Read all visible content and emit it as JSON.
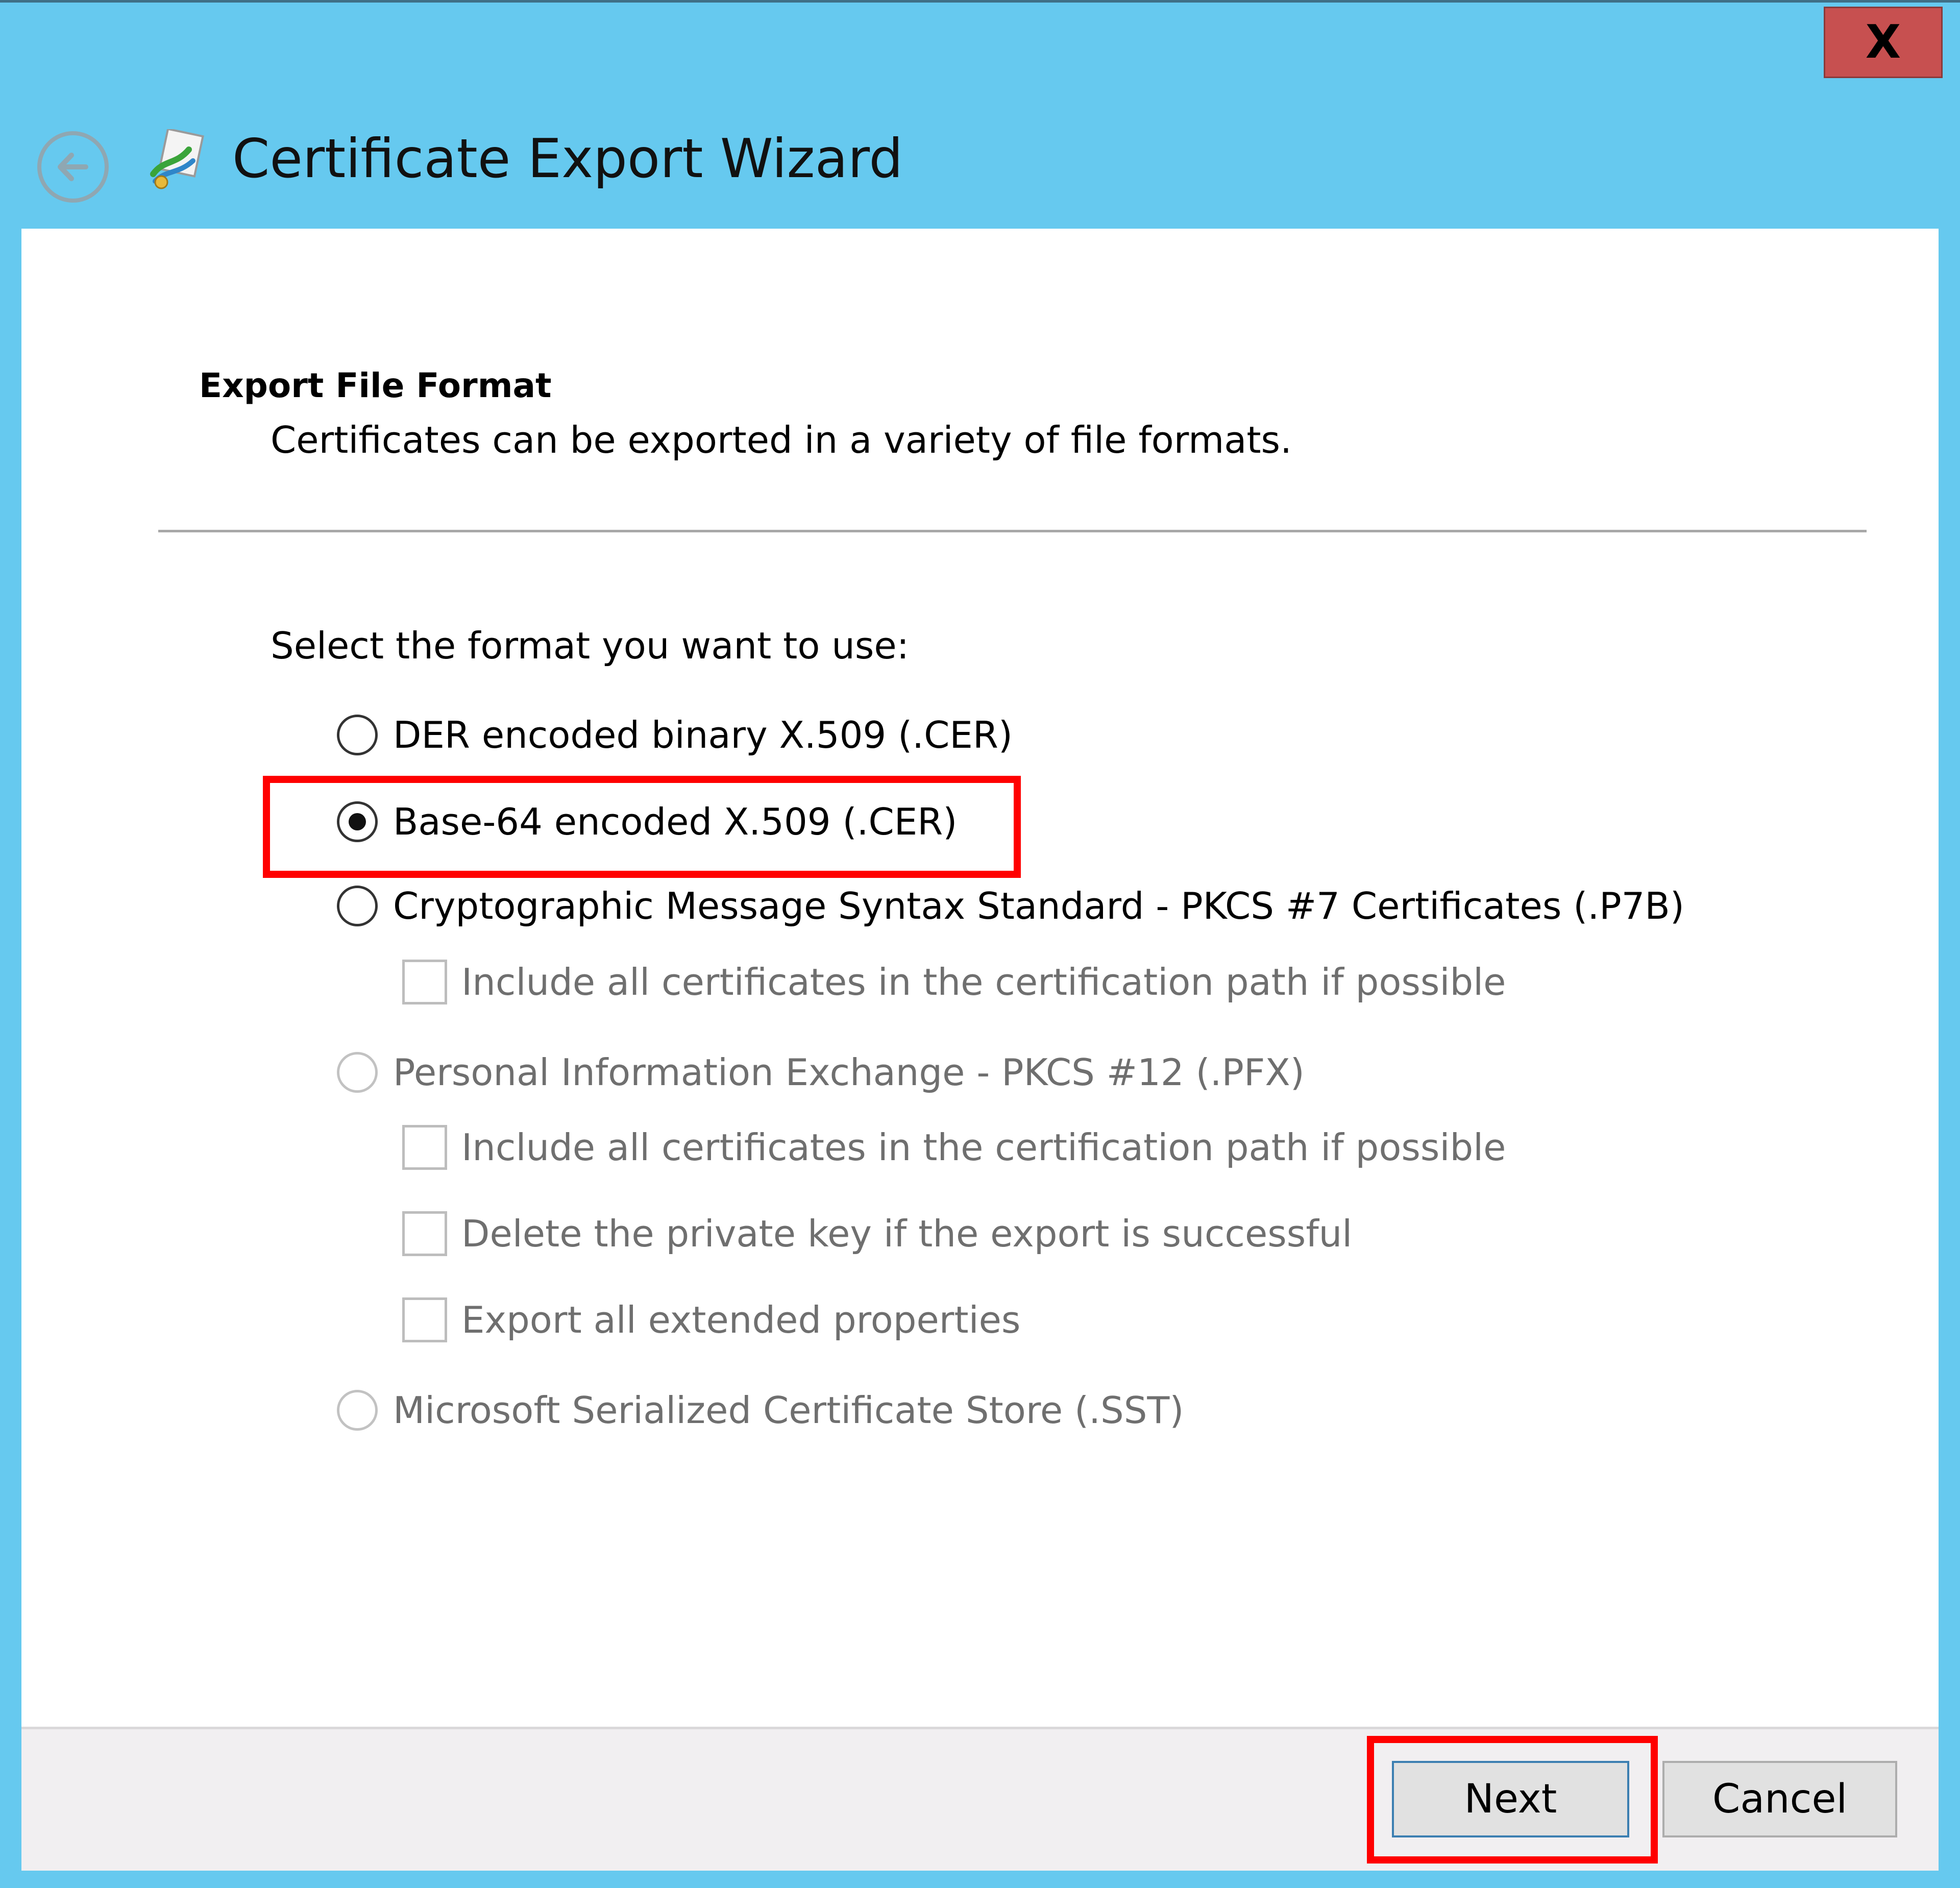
{
  "window": {
    "title": "Certificate Export Wizard",
    "close_label": "X"
  },
  "page": {
    "heading": "Export File Format",
    "subheading": "Certificates can be exported in a variety of file formats.",
    "prompt": "Select the format you want to use:"
  },
  "options": {
    "der": {
      "label": "DER encoded binary X.509 (.CER)",
      "selected": false,
      "enabled": true
    },
    "base64": {
      "label": "Base-64 encoded X.509 (.CER)",
      "selected": true,
      "enabled": true
    },
    "pkcs7": {
      "label": "Cryptographic Message Syntax Standard - PKCS #7 Certificates (.P7B)",
      "selected": false,
      "enabled": true
    },
    "pkcs7_include_path": {
      "label": "Include all certificates in the certification path if possible",
      "checked": false,
      "enabled": false
    },
    "pfx": {
      "label": "Personal Information Exchange - PKCS #12 (.PFX)",
      "selected": false,
      "enabled": false
    },
    "pfx_include_path": {
      "label": "Include all certificates in the certification path if possible",
      "checked": false,
      "enabled": false
    },
    "pfx_delete_key": {
      "label": "Delete the private key if the export is successful",
      "checked": false,
      "enabled": false
    },
    "pfx_export_props": {
      "label": "Export all extended properties",
      "checked": false,
      "enabled": false
    },
    "sst": {
      "label": "Microsoft Serialized Certificate Store (.SST)",
      "selected": false,
      "enabled": false
    }
  },
  "buttons": {
    "next": "Next",
    "cancel": "Cancel"
  },
  "colors": {
    "title_bar": "#66c9ef",
    "highlight": "#ff0000",
    "close_button": "#c75050"
  }
}
